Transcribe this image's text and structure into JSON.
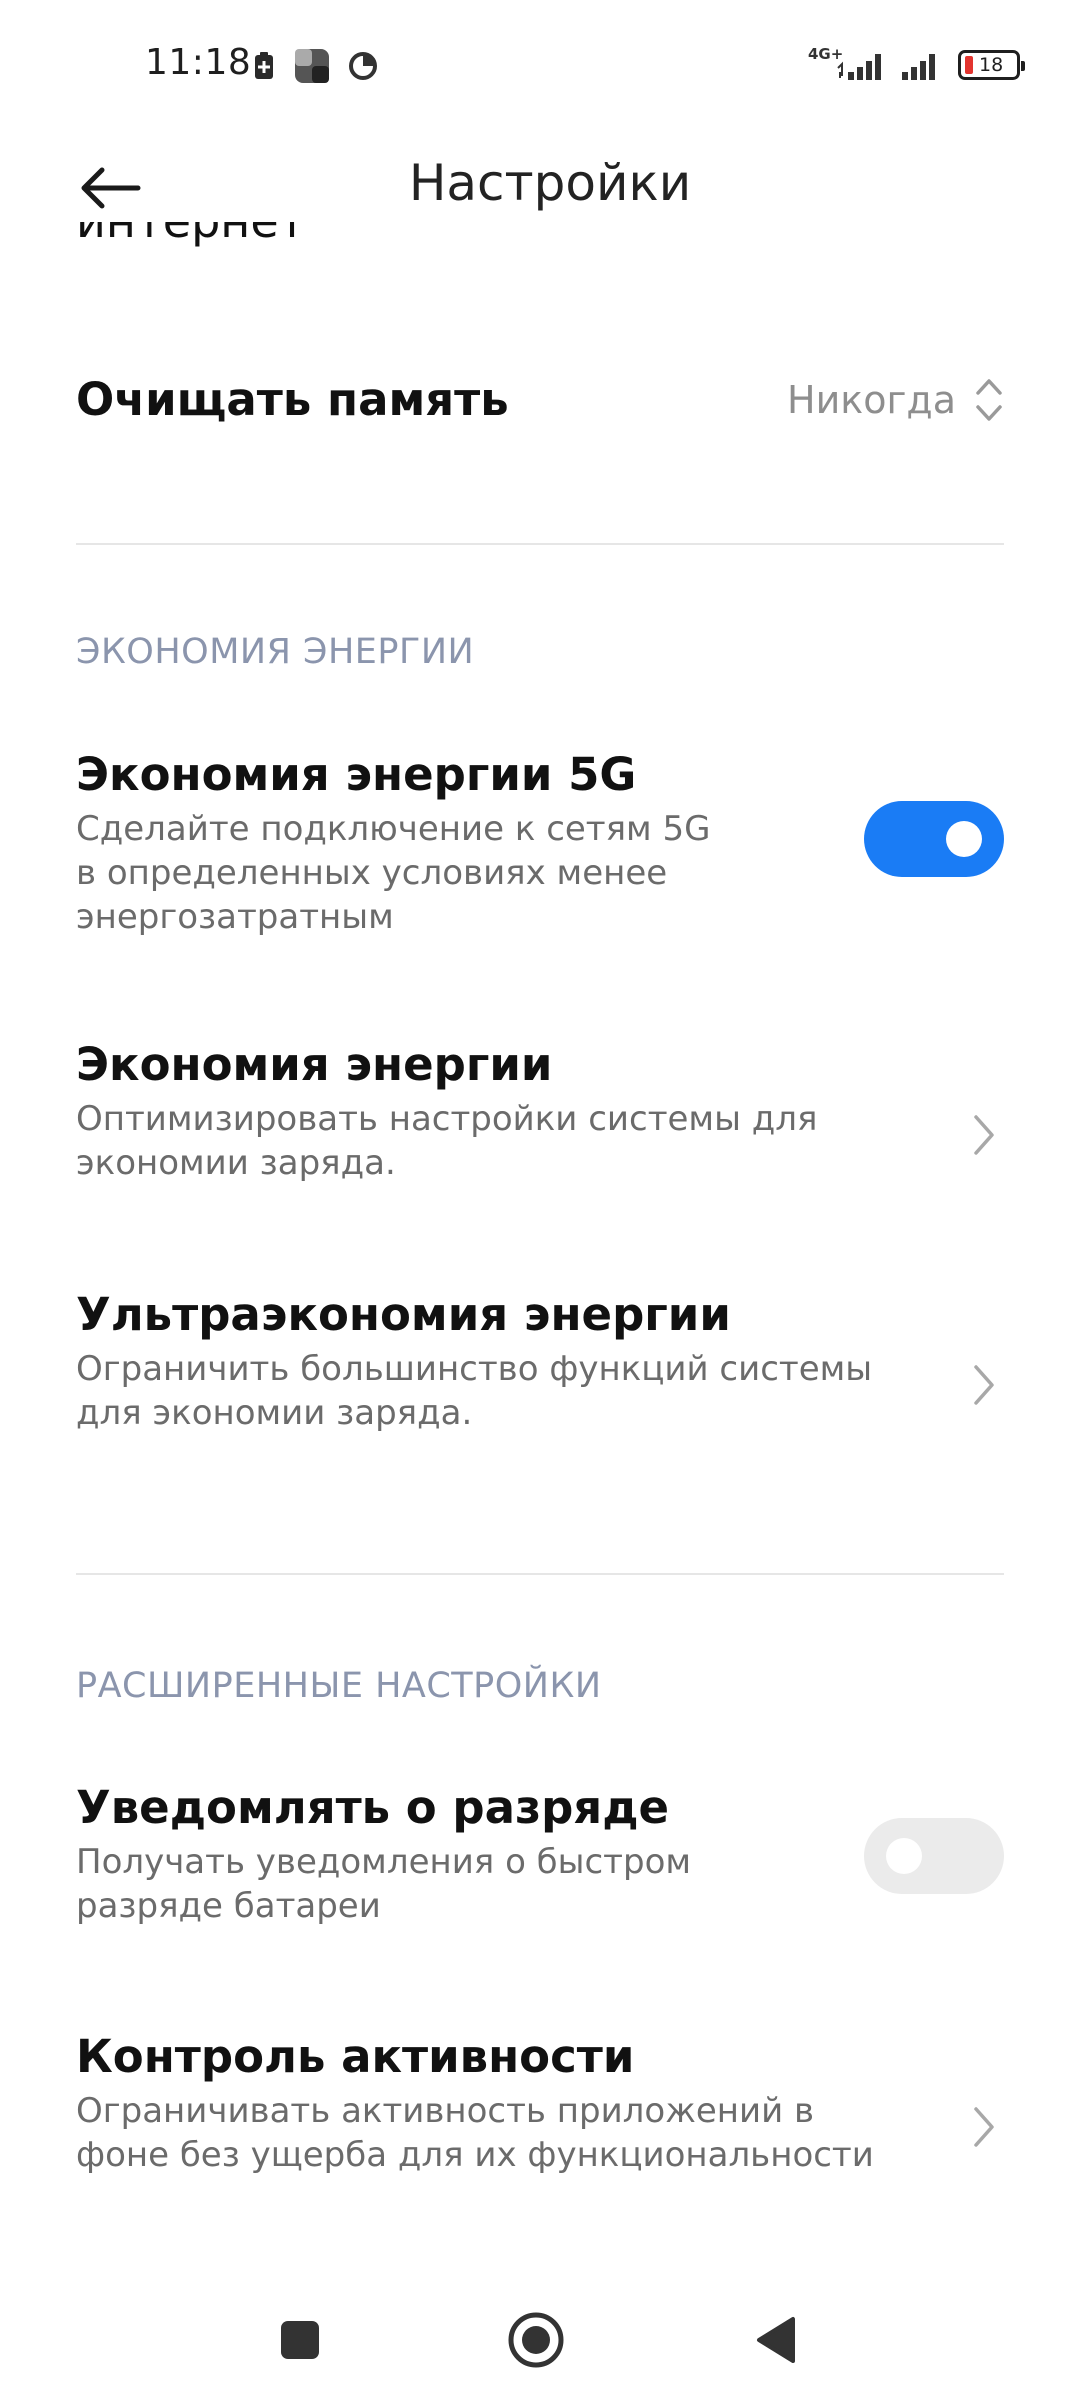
{
  "status_bar": {
    "time": "11:18",
    "network_label": "4G+",
    "battery_level": "18",
    "battery_color": "#e3342f"
  },
  "header": {
    "title": "Настройки",
    "back_icon": "arrow-left-icon"
  },
  "partial_row": {
    "text": "интернет"
  },
  "clear_memory": {
    "title": "Очищать память",
    "value": "Никогда",
    "icon": "up-down-chevron-icon"
  },
  "sections": {
    "energy_saving": {
      "header": "ЭКОНОМИЯ ЭНЕРГИИ",
      "items": [
        {
          "title": "Экономия энергии 5G",
          "subtitle": "Сделайте подключение к сетям 5G в определенных условиях менее энергозатратным",
          "control": "toggle",
          "state": "on"
        },
        {
          "title": "Экономия энергии",
          "subtitle": "Оптимизировать настройки системы для экономии заряда.",
          "control": "chevron"
        },
        {
          "title": "Ультраэкономия энергии",
          "subtitle": "Ограничить большинство функций системы для экономии заряда.",
          "control": "chevron"
        }
      ]
    },
    "advanced": {
      "header": "РАСШИРЕННЫЕ НАСТРОЙКИ",
      "items": [
        {
          "title": "Уведомлять о разряде",
          "subtitle": "Получать уведомления о быстром разряде батареи",
          "control": "toggle",
          "state": "off"
        },
        {
          "title": "Контроль активности",
          "subtitle": "Ограничивать активность приложений в фоне без ущерба для их функциональности",
          "control": "chevron"
        }
      ]
    }
  },
  "colors": {
    "accent": "#1a7cf5",
    "section_header": "#8b95ad",
    "subtitle": "#6b6b6b"
  },
  "nav_bar": {
    "icons": [
      "square-recents-icon",
      "circle-home-icon",
      "triangle-back-icon"
    ]
  }
}
